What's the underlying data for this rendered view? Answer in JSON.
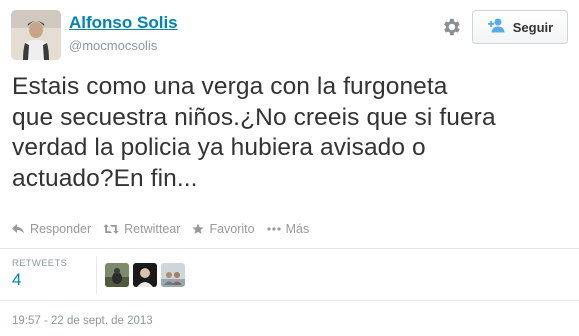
{
  "author": {
    "name": "Alfonso Solis",
    "handle": "@mocmocsolis"
  },
  "header": {
    "follow_label": "Seguir",
    "gear_icon": "gear-icon",
    "follow_icon": "person-plus-icon"
  },
  "tweet": {
    "text_lines": [
      "Estais como una verga con la furgoneta",
      "que secuestra niños.¿No creeis que si fuera",
      "verdad la policia ya hubiera avisado o",
      "actuado?En fin..."
    ]
  },
  "actions": {
    "reply": "Responder",
    "retweet": "Retwittear",
    "favorite": "Favorito",
    "more": "Más"
  },
  "stats": {
    "retweets_label": "RETWEETS",
    "retweets_count": "4"
  },
  "timestamp": "19:57 - 22 de sept. de 2013",
  "colors": {
    "link": "#0084b4",
    "muted": "#8899a6",
    "text": "#333333"
  }
}
